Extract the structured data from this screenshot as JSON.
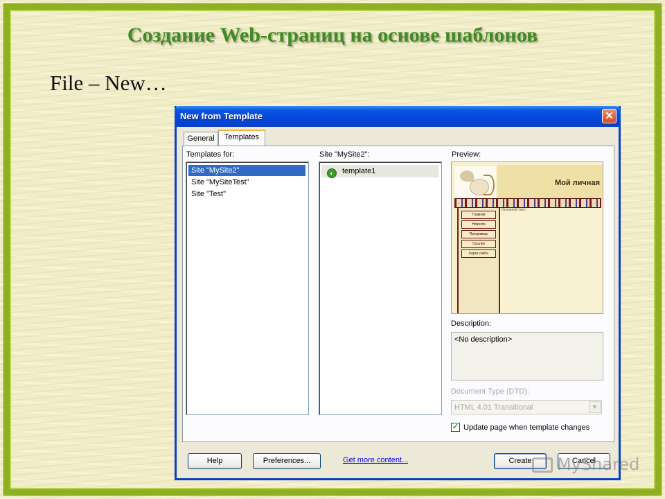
{
  "slide": {
    "title": "Создание Web-страниц на основе шаблонов",
    "subtitle": "File – New…"
  },
  "dialog": {
    "title": "New from Template",
    "tabs": [
      {
        "label": "General",
        "active": false
      },
      {
        "label": "Templates",
        "active": true
      }
    ],
    "templates_for_label": "Templates for:",
    "sites": [
      "Site \"MySite2\"",
      "Site \"MySiteTest\"",
      "Site \"Test\""
    ],
    "selected_site_index": 0,
    "site_templates_label": "Site \"MySite2\":",
    "templates": [
      "template1"
    ],
    "preview_label": "Preview:",
    "preview": {
      "header_text": "Мой личная",
      "main_text": "Основной текст",
      "nav_buttons": [
        "Главная",
        "Новости",
        "Программы",
        "Ссылки",
        "Карта сайта"
      ]
    },
    "description_label": "Description:",
    "description_value": "<No description>",
    "doctype_label": "Document Type (DTD):",
    "doctype_value": "HTML 4.01 Transitional",
    "update_checkbox_label": "Update page when template changes",
    "update_checked": true,
    "buttons": {
      "help": "Help",
      "preferences": "Preferences...",
      "get_more": "Get more content...",
      "create": "Create",
      "cancel": "Cancel"
    }
  },
  "watermark": "MyShared",
  "colors": {
    "frame": "#8fb021",
    "title_green": "#3f8a25",
    "xp_titlebar": "#0a55e3",
    "selection": "#316ac5"
  }
}
